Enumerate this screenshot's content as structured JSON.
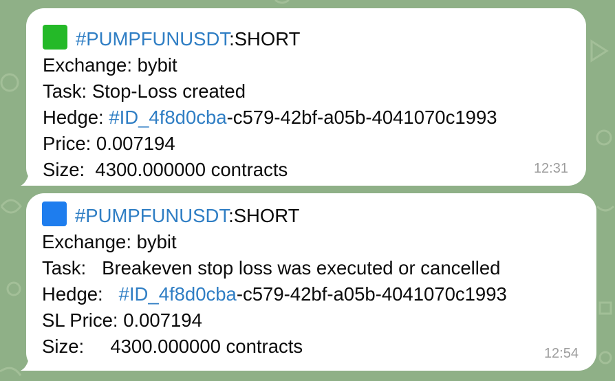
{
  "messages": [
    {
      "status_icon": "green-square-icon",
      "status_color": "#24b928",
      "symbol_tag": "#PUMPFUNUSDT",
      "side": ":SHORT",
      "exchange": "Exchange: bybit",
      "task": "Task: Stop-Loss created",
      "hedge_label": "Hedge: ",
      "hedge_tag": "#ID_4f8d0cba",
      "hedge_rest": "-c579-42bf-a05b-4041070c1993",
      "price": "Price: 0.007194",
      "size": "Size:  4300.000000 contracts",
      "time": "12:31"
    },
    {
      "status_icon": "blue-square-icon",
      "status_color": "#1e7dee",
      "symbol_tag": "#PUMPFUNUSDT",
      "side": ":SHORT",
      "exchange": "Exchange: bybit",
      "task": "Task:   Breakeven stop loss was executed or cancelled",
      "hedge_label": "Hedge:   ",
      "hedge_tag": "#ID_4f8d0cba",
      "hedge_rest": "-c579-42bf-a05b-4041070c1993",
      "price": "SL Price: 0.007194",
      "size": "Size:     4300.000000 contracts",
      "time": "12:54"
    }
  ],
  "theme": {
    "link_color": "#2f7ec4",
    "bubble_color": "#ffffff",
    "wallpaper_color": "#8fb087"
  }
}
